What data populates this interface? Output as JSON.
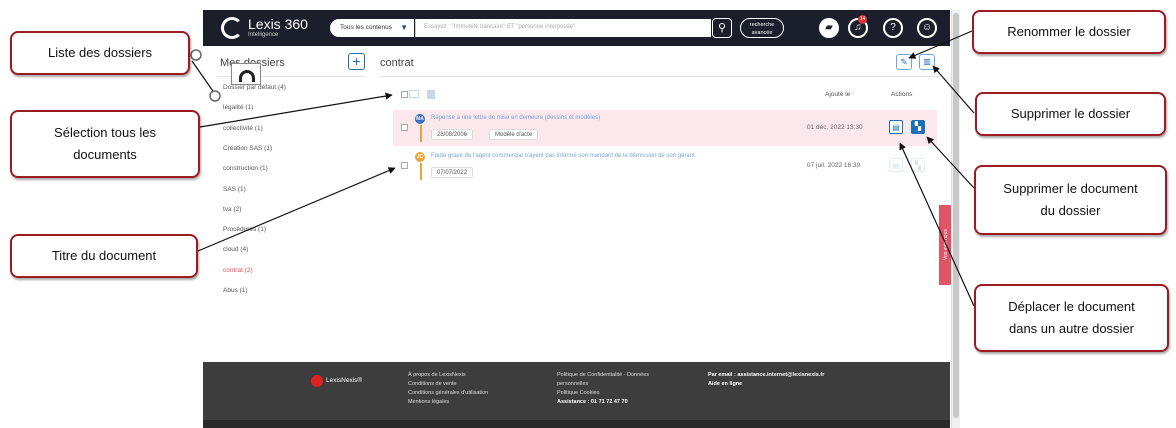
{
  "header": {
    "logo_name": "Lexis 360",
    "logo_sub": "Intelligence",
    "scope_label": "Tous les contenus",
    "search_placeholder": "Essayez : \"Immunité bancaire\" ET \"personne interposée\"",
    "advanced_search_label": "recherche avancée",
    "notification_count": "14"
  },
  "sidebar": {
    "title": "Mes dossiers",
    "add_label": "+",
    "folders": [
      {
        "label": "Dossier par défaut (4)",
        "active": false
      },
      {
        "label": "légalité (1)",
        "active": false
      },
      {
        "label": "collectivité (1)",
        "active": false
      },
      {
        "label": "Création SAS (1)",
        "active": false
      },
      {
        "label": "construction (1)",
        "active": false
      },
      {
        "label": "SAS (1)",
        "active": false
      },
      {
        "label": "tva (2)",
        "active": false
      },
      {
        "label": "Procédures (1)",
        "active": false
      },
      {
        "label": "cloud (4)",
        "active": false
      },
      {
        "label": "contrat (2)",
        "active": true
      },
      {
        "label": "Abus (1)",
        "active": false
      }
    ]
  },
  "main": {
    "folder_title": "contrat",
    "col_added": "Ajouté le",
    "col_actions": "Actions",
    "documents": [
      {
        "badge": "MA",
        "badge_color": "#3a6fc4",
        "title": "Réponse à une lettre de mise en demeure (dessins et modèles)",
        "tags": [
          "28/08/2006",
          "Modèle d'acte"
        ],
        "added": "01 déc. 2022 13:30",
        "highlighted": true
      },
      {
        "badge": "JC",
        "badge_color": "#e5a53b",
        "title": "Faute grave de l'agent commercial n'ayant pas informé son mandant de la démission de son gérant",
        "tags": [
          "07/07/2022"
        ],
        "added": "07 juil. 2022 16:39",
        "highlighted": false
      }
    ],
    "side_tab_label": "Vos avis nous"
  },
  "footer": {
    "logo": "LexisNexis®",
    "col1": [
      "À propos de LexisNexis",
      "Conditions de vente",
      "Conditions générales d'utilisation",
      "Mentions légales"
    ],
    "col2": [
      "Politique de Confidentialité - Données",
      "personnelles",
      "Politique Cookies",
      "Assistance : 01 71 72 47 70"
    ],
    "col3": [
      "Par email : assistance.internet@lexisnexis.fr",
      "Aide en ligne"
    ]
  },
  "callouts": {
    "liste": "Liste des dossiers",
    "selection_l1": "Sélection tous les",
    "selection_l2": "documents",
    "titre": "Titre du document",
    "renommer": "Renommer le dossier",
    "supprimer_dossier": "Supprimer le dossier",
    "supprimer_doc_l1": "Supprimer le document",
    "supprimer_doc_l2": "du dossier",
    "deplacer_l1": "Déplacer le document",
    "deplacer_l2": "dans un autre dossier"
  },
  "colors": {
    "header_bg": "#1a1f2b",
    "accent_blue": "#1d6fb8",
    "active_folder": "#e05555",
    "callout_border": "#9c1c24",
    "highlight_row": "#fbe8ec"
  }
}
